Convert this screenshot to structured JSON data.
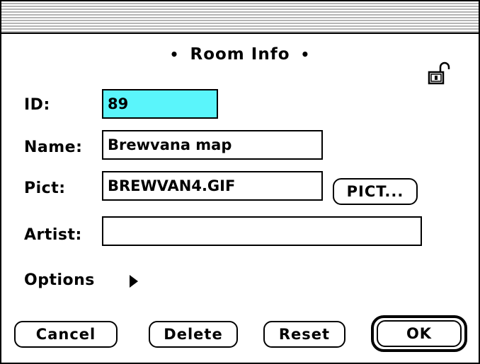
{
  "dialog": {
    "title": "Room Info",
    "title_bullet_left": "•",
    "title_bullet_right": "•"
  },
  "icons": {
    "lock": "unlocked-padlock-icon",
    "options_disclosure": "disclosure-triangle-right-icon"
  },
  "fields": {
    "id": {
      "label": "ID:",
      "value": "89",
      "selected": true
    },
    "name": {
      "label": "Name:",
      "value": "Brewvana map"
    },
    "pict": {
      "label": "Pict:",
      "value": "BREWVAN4.GIF"
    },
    "artist": {
      "label": "Artist:",
      "value": ""
    }
  },
  "options": {
    "label": "Options"
  },
  "buttons": {
    "pict": "PICT...",
    "cancel": "Cancel",
    "delete": "Delete",
    "reset": "Reset",
    "ok": "OK"
  },
  "colors": {
    "selection_highlight": "#5af5fb",
    "title_bar_stripe": "#b4b4b4"
  }
}
